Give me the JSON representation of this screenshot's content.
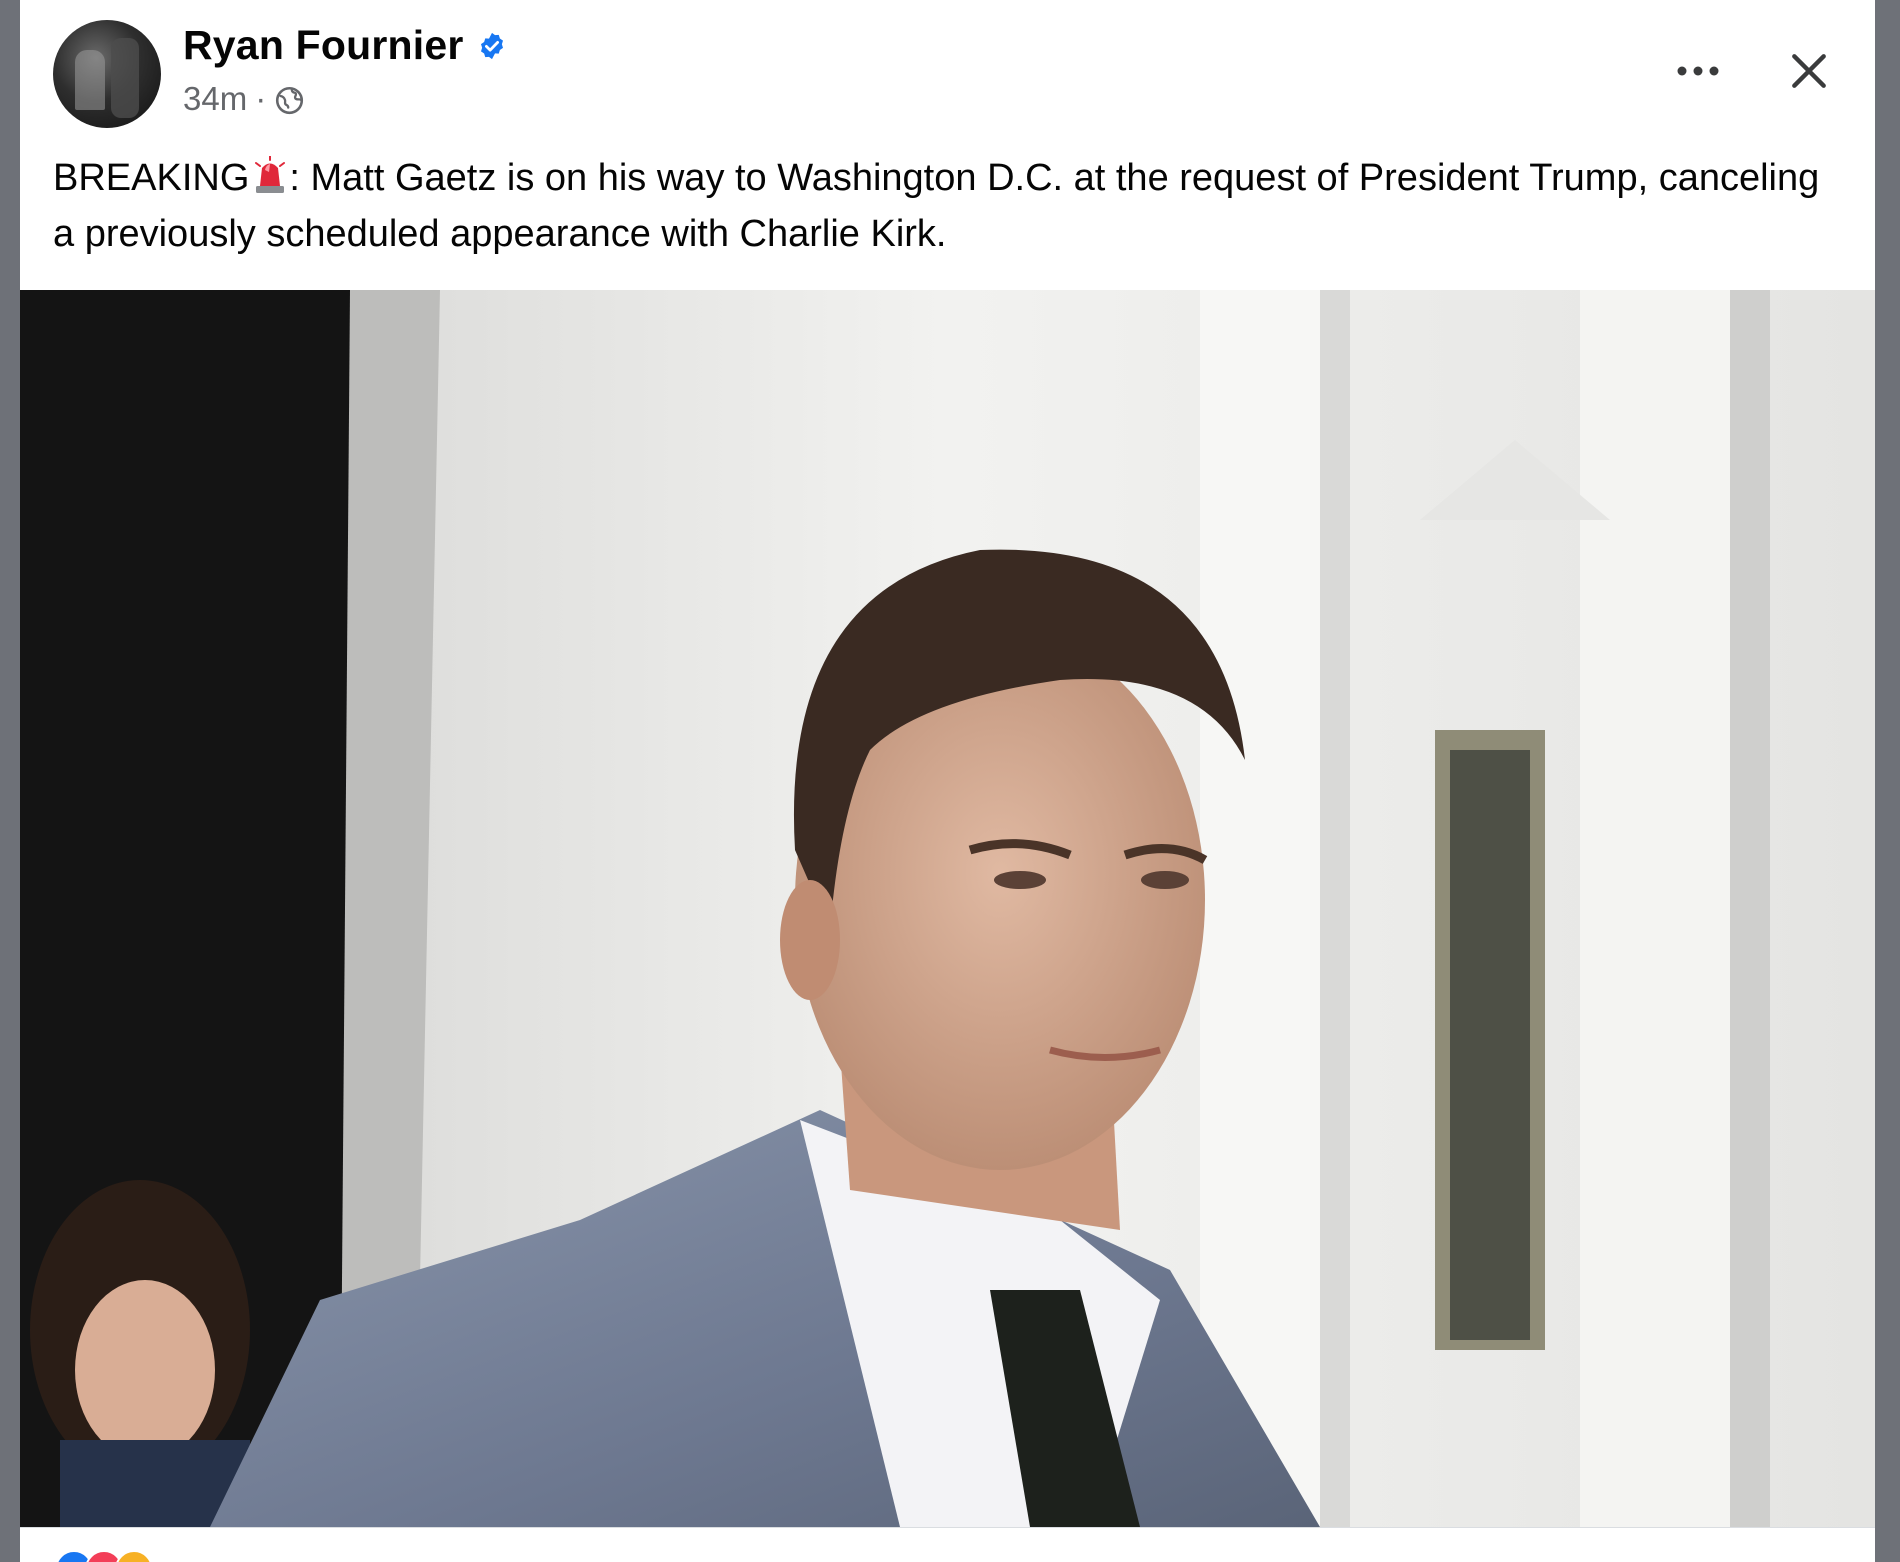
{
  "post": {
    "author": "Ryan Fournier",
    "timestamp": "34m",
    "meta_separator": "·",
    "text_before_emoji": "BREAKING",
    "text_after_emoji": ": Matt Gaetz is on his way to Washington D.C. at the request of President Trump, canceling a previously scheduled appearance with Charlie Kirk.",
    "emoji_icon": "police-siren-icon",
    "audience_icon": "globe-icon",
    "verified_icon": "verified-badge-icon"
  },
  "colors": {
    "verified": "#1877f2",
    "text_primary": "#050505",
    "text_secondary": "#65676b",
    "siren": "#e0283a"
  }
}
